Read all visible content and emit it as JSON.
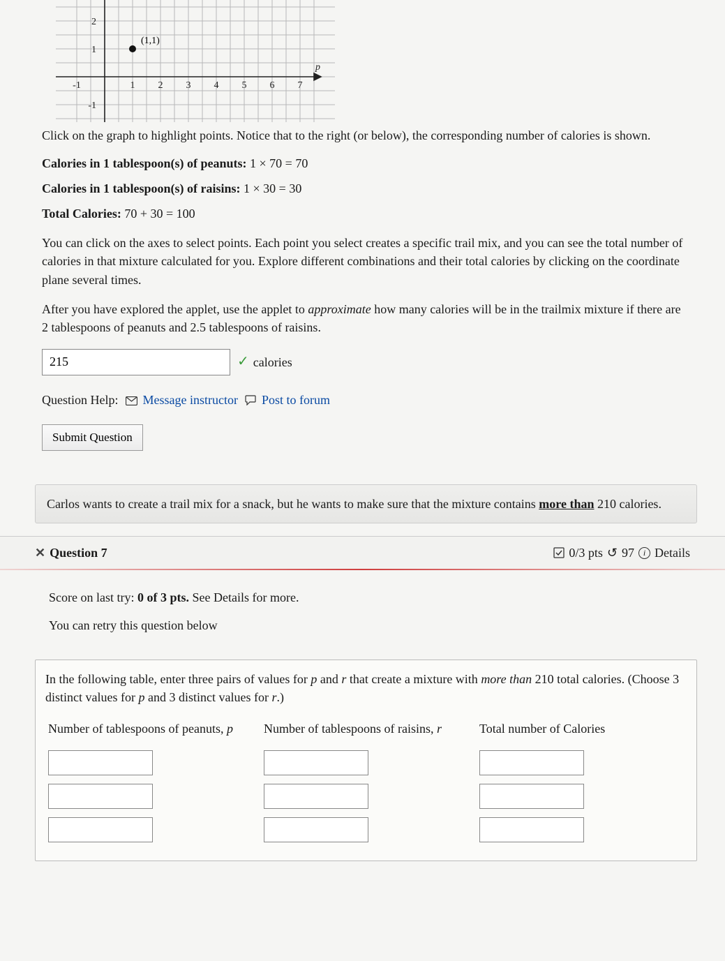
{
  "chart_data": {
    "type": "scatter",
    "x_range": [
      -1,
      7.5
    ],
    "y_range": [
      -1.5,
      2.5
    ],
    "x_ticks": [
      -1,
      1,
      2,
      3,
      4,
      5,
      6,
      7
    ],
    "y_ticks": [
      -1,
      1,
      2
    ],
    "x_axis_label": "p",
    "points": [
      {
        "x": 1,
        "y": 1,
        "label": "(1,1)"
      }
    ],
    "grid": true
  },
  "graph_instruction": "Click on the graph to highlight points. Notice that to the right (or below), the corresponding number of calories is shown.",
  "calc": {
    "peanuts_label": "Calories in 1 tablespoon(s) of peanuts:",
    "peanuts_expr": "1 × 70 = 70",
    "raisins_label": "Calories in 1 tablespoon(s) of raisins:",
    "raisins_expr": "1 × 30 = 30",
    "total_label": "Total Calories:",
    "total_expr": "70 + 30 = 100"
  },
  "paragraphs": {
    "explore": "You can click on the axes to select points. Each point you select creates a specific trail mix, and you can see the total number of calories in that mixture calculated for you. Explore different combinations and their total calories by clicking on the coordinate plane several times.",
    "task_pre": "After you have explored the applet, use the applet to ",
    "task_em": "approximate",
    "task_post": " how many calories will be in the trailmix mixture if there are 2 tablespoons of peanuts and 2.5 tablespoons of raisins."
  },
  "answer": {
    "value": "215",
    "unit": "calories"
  },
  "help": {
    "label": "Question Help:",
    "msg": "Message instructor",
    "forum": "Post to forum"
  },
  "submit": "Submit Question",
  "context": {
    "pre": "Carlos wants to create a trail mix for a snack, but he wants to make sure that the mixture contains ",
    "emph": "more than",
    "post": " 210 calories."
  },
  "q7": {
    "title": "Question 7",
    "pts": "0/3 pts",
    "retries": "97",
    "details": "Details",
    "score_line_pre": "Score on last try: ",
    "score_line_bold": "0 of 3 pts.",
    "score_line_post": " See Details for more.",
    "retry_line": "You can retry this question below",
    "intro_pre": "In the following table, enter three pairs of values for ",
    "intro_mid1": " and ",
    "intro_mid2": " that create a mixture with ",
    "intro_em": "more than",
    "intro_mid3": " 210 total calories. (Choose 3 distinct values for ",
    "intro_mid4": " and 3 distinct values for ",
    "intro_end": ".)",
    "var_p": "p",
    "var_r": "r",
    "headers": {
      "p": "Number of tablespoons of peanuts, ",
      "r": "Number of tablespoons of raisins, ",
      "t": "Total number of Calories"
    }
  }
}
